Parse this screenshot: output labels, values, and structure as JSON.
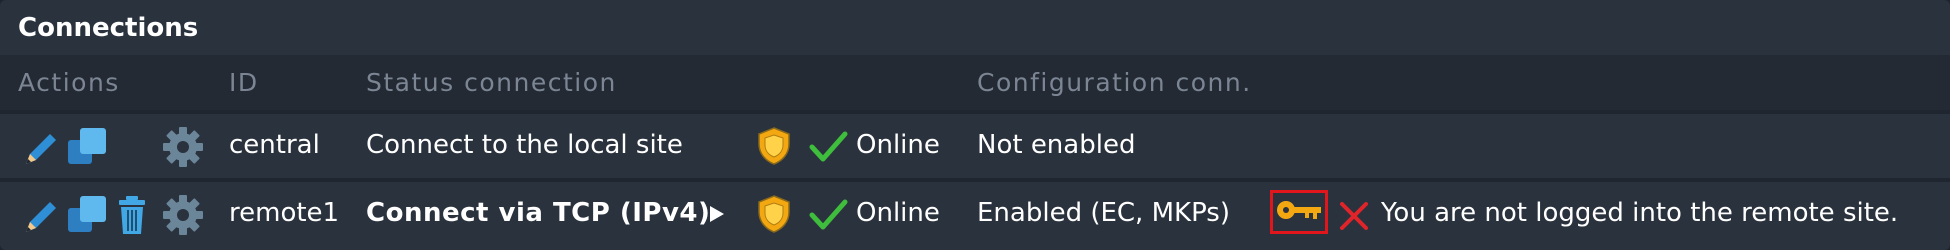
{
  "panel": {
    "title": "Connections"
  },
  "columns": {
    "actions": "Actions",
    "id": "ID",
    "status": "Status connection",
    "config": "Configuration conn."
  },
  "rows": [
    {
      "id": "central",
      "connection": "Connect to the local site",
      "status": "Online",
      "config": "Not enabled",
      "has_delete": false,
      "has_key": false,
      "message": ""
    },
    {
      "id": "remote1",
      "connection": "Connect via TCP (IPv4)",
      "status": "Online",
      "config": "Enabled (EC, MKPs)",
      "has_delete": true,
      "has_key": true,
      "message": "You are not logged into the remote site."
    }
  ],
  "colors": {
    "background": "#2a323e",
    "header": "#232a34",
    "pencil": "#2e8fd6",
    "clone": "#41a7e5",
    "delete": "#41a7e5",
    "gear": "#6b8599",
    "shield": "#f3a812",
    "check": "#3fbd3c",
    "key": "#f3a812",
    "cross": "#e0242a",
    "highlight": "#e0161c"
  },
  "icons": [
    "edit-icon",
    "clone-icon",
    "delete-icon",
    "settings-icon",
    "shield-icon",
    "check-icon",
    "key-icon",
    "cross-icon",
    "expand-icon"
  ]
}
